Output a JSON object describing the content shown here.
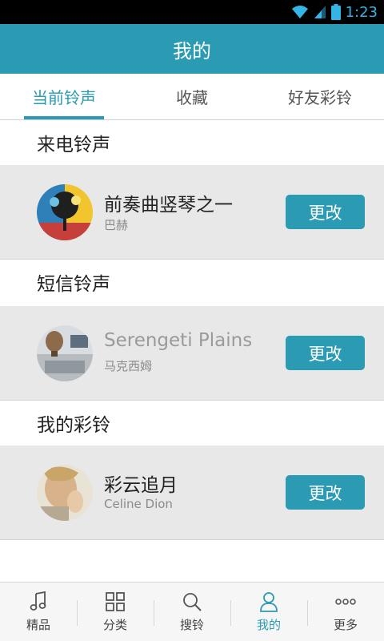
{
  "status_bar": {
    "time": "1:23"
  },
  "header": {
    "title": "我的"
  },
  "tabs": [
    {
      "label": "当前铃声",
      "active": true
    },
    {
      "label": "收藏",
      "active": false
    },
    {
      "label": "好友彩铃",
      "active": false
    }
  ],
  "sections": [
    {
      "title": "来电铃声",
      "song": "前奏曲竖琴之一",
      "artist": "巴赫",
      "button": "更改",
      "dim": false,
      "icon": "album-art-tree"
    },
    {
      "title": "短信铃声",
      "song": "Serengeti Plains",
      "artist": "马克西姆",
      "button": "更改",
      "dim": true,
      "icon": "album-art-balloon"
    },
    {
      "title": "我的彩铃",
      "song": "彩云追月",
      "artist": "Celine Dion",
      "button": "更改",
      "dim": false,
      "icon": "album-art-portrait"
    }
  ],
  "bottom_nav": [
    {
      "label": "精品",
      "icon": "music-note-icon",
      "active": false
    },
    {
      "label": "分类",
      "icon": "grid-icon",
      "active": false
    },
    {
      "label": "搜铃",
      "icon": "search-icon",
      "active": false
    },
    {
      "label": "我的",
      "icon": "person-icon",
      "active": true
    },
    {
      "label": "更多",
      "icon": "more-icon",
      "active": false
    }
  ],
  "colors": {
    "accent": "#2a9bb3",
    "row_bg": "#e8e8e8",
    "status_time": "#33b5e5"
  }
}
